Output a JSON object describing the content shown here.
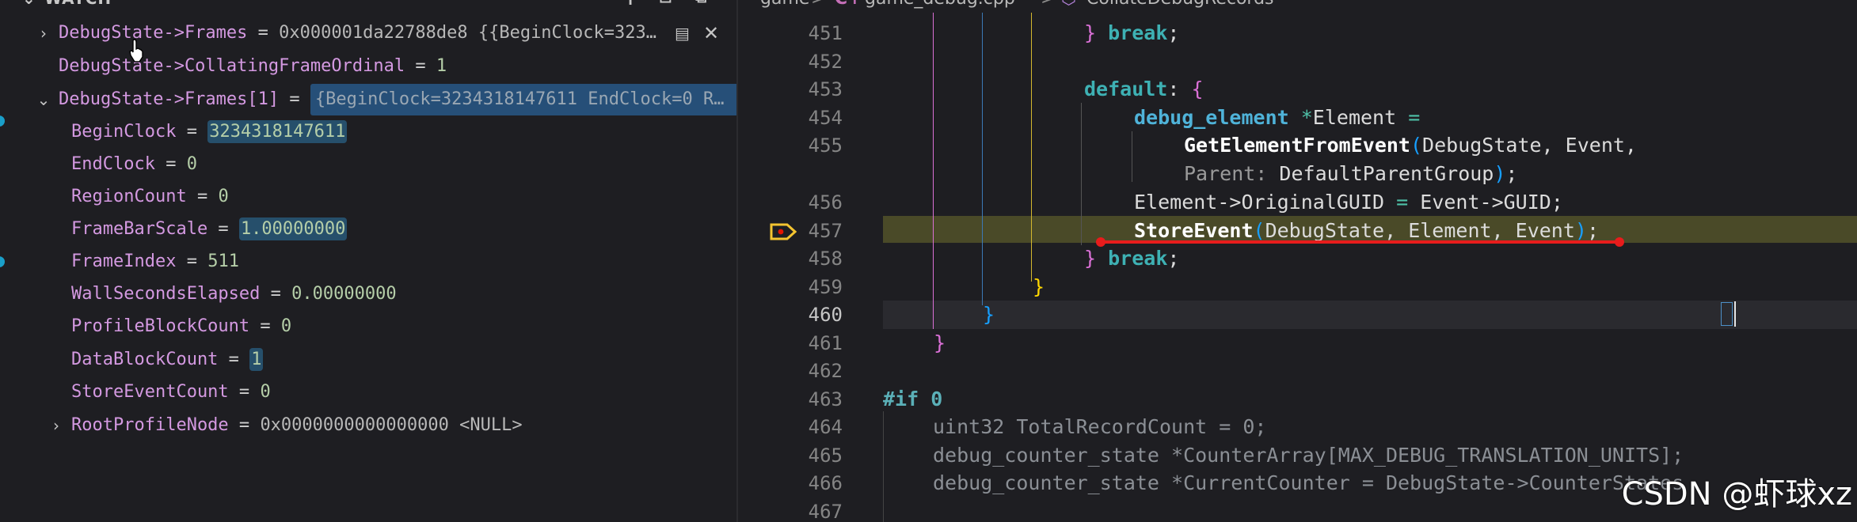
{
  "watch": {
    "title": "WATCH",
    "rows": [
      {
        "name": "DebugState->Frames",
        "eq": " = ",
        "value": "0x000001da22788de8",
        "extra": " {{BeginClock=323…"
      },
      {
        "name": "DebugState->CollatingFrameOrdinal",
        "eq": " = ",
        "value": "1"
      },
      {
        "name": "DebugState->Frames[1]",
        "eq": " = ",
        "value": "{BeginClock=3234318147611 EndClock=0 R…"
      },
      {
        "name": "BeginClock",
        "eq": " = ",
        "value": "3234318147611"
      },
      {
        "name": "EndClock",
        "eq": " = ",
        "value": "0"
      },
      {
        "name": "RegionCount",
        "eq": " = ",
        "value": "0"
      },
      {
        "name": "FrameBarScale",
        "eq": " = ",
        "value": "1.00000000"
      },
      {
        "name": "FrameIndex",
        "eq": " = ",
        "value": "511"
      },
      {
        "name": "WallSecondsElapsed",
        "eq": " = ",
        "value": "0.00000000"
      },
      {
        "name": "ProfileBlockCount",
        "eq": " = ",
        "value": "0"
      },
      {
        "name": "DataBlockCount",
        "eq": " = ",
        "value": "1"
      },
      {
        "name": "StoreEventCount",
        "eq": " = ",
        "value": "0"
      },
      {
        "name": "RootProfileNode",
        "eq": " = ",
        "value": "0x0000000000000000",
        "extra": " <NULL>"
      }
    ]
  },
  "breadcrumb": {
    "folder": "game",
    "sep": ">",
    "file_icon": "C+",
    "file": "game_debug.cpp",
    "symbol": "CollateDebugRecords"
  },
  "editor": {
    "line_numbers": [
      "451",
      "452",
      "453",
      "454",
      "455",
      "",
      "456",
      "457",
      "458",
      "459",
      "460",
      "461",
      "462",
      "463",
      "464",
      "465",
      "466",
      "467"
    ],
    "tokens": {
      "l451_brace": "}",
      "l451_kw": "break",
      "l451_semi": ";",
      "l453_kw": "default",
      "l453_colon": ":",
      "l453_brace": "{",
      "l454_type": "debug_element",
      "l454_star": "*",
      "l454_var": "Element",
      "l454_eq": "=",
      "l455_fn": "GetElementFromEvent",
      "l455_paren": "(",
      "l455_args": "DebugState, Event,",
      "l455b_hint": "Parent:",
      "l455b_arg": "DefaultParentGroup",
      "l455b_paren": ")",
      "l455b_semi": ";",
      "l456_lhs": "Element->OriginalGUID",
      "l456_eq": "=",
      "l456_rhs": "Event->GUID;",
      "l457_fn": "StoreEvent",
      "l457_paren": "(",
      "l457_args": "DebugState, Element, Event",
      "l457_cparen": ")",
      "l457_semi": ";",
      "l458_brace": "}",
      "l458_kw": "break",
      "l458_semi": ";",
      "l459_brace": "}",
      "l460_brace": "}",
      "l461_brace": "}",
      "l463_pp": "#if",
      "l463_num": "0",
      "l464_code": "uint32 TotalRecordCount = 0;",
      "l465_code": "debug_counter_state *CounterArray[MAX_DEBUG_TRANSLATION_UNITS];",
      "l466_code": "debug_counter_state *CurrentCounter = DebugState->CounterStates"
    }
  },
  "watermark": "CSDN @虾球xz",
  "colors": {
    "background": "#1e1e22",
    "debug_line": "#4a4a28",
    "breakpoint_arrow": "#f4c430",
    "underline": "#e81c1c"
  },
  "icons": [
    "chevron-right-icon",
    "chevron-down-icon",
    "add-expression-icon",
    "collapse-all-icon",
    "remove-all-icon",
    "view-binary-icon",
    "close-icon",
    "breakpoint-arrow-icon",
    "file-cpp-icon",
    "symbol-method-icon",
    "mouse-pointer-icon"
  ]
}
